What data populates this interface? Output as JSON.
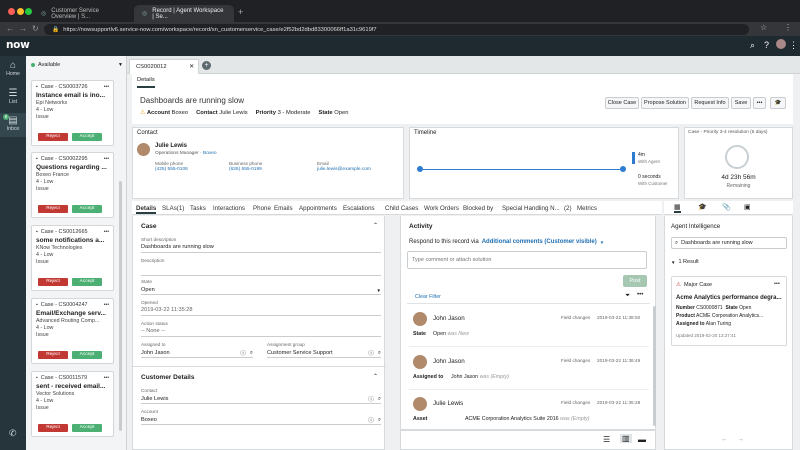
{
  "browser": {
    "tabs": [
      {
        "title": "Customer Service Overview | S...",
        "active": false
      },
      {
        "title": "Record | Agent Workspace | Se...",
        "active": true
      }
    ],
    "url": "https://nowsupportlv6.service-now.com/workspace/record/sn_customerservice_case/e2f52bd2dbd83300066ff1a31c9619f7"
  },
  "app": {
    "logo": "now"
  },
  "leftnav": [
    {
      "icon": "home-icon",
      "label": "Home"
    },
    {
      "icon": "list-icon",
      "label": "List"
    },
    {
      "icon": "inbox-icon",
      "label": "Inbox",
      "badge": "6"
    }
  ],
  "inbox": {
    "status": "Available",
    "cards": [
      {
        "number": "Case - CS0003726",
        "title": "Instance email is ino...",
        "company": "Epi Networks",
        "priority": "4 - Low",
        "type": "Issue"
      },
      {
        "number": "Case - CS0002295",
        "title": "Questions regarding ...",
        "company": "Boxeo France",
        "priority": "4 - Low",
        "type": "Issue"
      },
      {
        "number": "Case - CS0012665",
        "title": "some notifications a...",
        "company": "KNow Technologies",
        "priority": "4 - Low",
        "type": "Issue"
      },
      {
        "number": "Case - CS0004247",
        "title": "Email/Exchange serv...",
        "company": "Advanced Routing Comp...",
        "priority": "4 - Low",
        "type": "Issue"
      },
      {
        "number": "Case - CS0011579",
        "title": "sent - received email...",
        "company": "Vector Solutions",
        "priority": "4 - Low",
        "type": "Issue"
      }
    ],
    "reject_label": "Reject",
    "accept_label": "Accept"
  },
  "record": {
    "tab": "CS0020012",
    "details_tab": "Details",
    "title": "Dashboards are running slow",
    "account_label": "Account",
    "account": "Boxeo",
    "contact_label": "Contact",
    "contact": "Julie Lewis",
    "priority_label": "Priority",
    "priority": "3 - Moderate",
    "state_label": "State",
    "state": "Open",
    "actions": [
      "Close Case",
      "Propose Solution",
      "Request Info",
      "Save"
    ]
  },
  "contact_card": {
    "header": "Contact",
    "name": "Julie Lewis",
    "role": "Operations Manager",
    "company": "Boxeo",
    "mobile_label": "Mobile phone",
    "mobile": "(425) 555-0106",
    "business_label": "Business phone",
    "business": "(626) 555-0199",
    "email_label": "Email",
    "email": "julie.lewis@example.com"
  },
  "timeline": {
    "header": "Timeline",
    "top_value": "4m",
    "top_label": "With Agent",
    "bottom_value": "0 seconds",
    "bottom_label": "With Customer"
  },
  "sla": {
    "header": "Case - Priority 3-4 resolution (5 days)",
    "time": "4d 23h 56m",
    "label": "Remaining"
  },
  "subtabs": [
    "Details",
    "SLAs(1)",
    "Tasks",
    "Interactions",
    "Phone",
    "Emails",
    "Appointments",
    "Escalations",
    "Child Cases",
    "Work Orders",
    "Blocked by",
    "Special Handling N...",
    "(2)",
    "Metrics"
  ],
  "case_form": {
    "header": "Case",
    "short_desc_label": "Short description",
    "short_desc": "Dashboards are running slow",
    "description_label": "Description",
    "state_label": "State",
    "state": "Open",
    "opened_label": "Opened",
    "opened": "2019-03-22 11:35:28",
    "action_status_label": "Action status",
    "action_status": "-- None --",
    "assigned_label": "Assigned to",
    "assigned": "John Jason",
    "group_label": "Assignment group",
    "group": "Customer Service Support",
    "customer_header": "Customer Details",
    "contact_label": "Contact",
    "contact": "Julie Lewis",
    "account_label": "Account",
    "account": "Boxeo"
  },
  "activity": {
    "header": "Activity",
    "respond_text": "Respond to this record via",
    "respond_link": "Additional comments (Customer visible)",
    "placeholder": "Type comment or attach solution",
    "post_label": "Post",
    "clear_filter": "Clear Filter",
    "entries": [
      {
        "name": "John Jason",
        "type": "Field changes",
        "time": "2019-03-22 11:38:50",
        "field": "State",
        "value": "Open",
        "old": "was New"
      },
      {
        "name": "John Jason",
        "type": "Field changes",
        "time": "2019-03-22 11:38:49",
        "field": "Assigned to",
        "value": "John Jason",
        "old": "was (Empty)"
      },
      {
        "name": "Julie Lewis",
        "type": "Field changes",
        "time": "2019-03-22 11:35:28",
        "field": "Asset",
        "value": "ACME Corporation Analytics Suite 2016",
        "old": "was (Empty)"
      }
    ]
  },
  "agent_intel": {
    "header": "Agent Intelligence",
    "search": "Dashboards are running slow",
    "results": "1 Result",
    "badge": "Major Case",
    "title": "Acme Analytics performance degra...",
    "number_label": "Number",
    "number": "CS0000871",
    "state_label": "State",
    "state": "Open",
    "product_label": "Product",
    "product": "ACME Corporation Analytics...",
    "assigned_label": "Assigned to",
    "assigned": "Alan Turing",
    "updated": "Updated 2019-02-20 13:27:41"
  }
}
